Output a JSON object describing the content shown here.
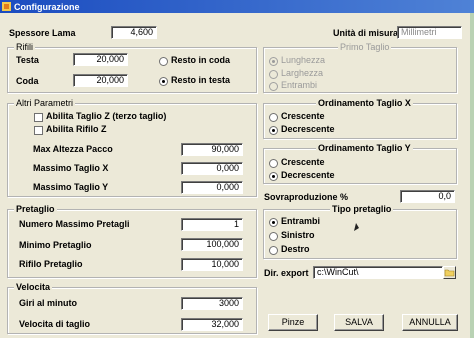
{
  "window": {
    "title": "Configurazione"
  },
  "spessore": {
    "label": "Spessore Lama",
    "value": "4,600"
  },
  "unita": {
    "label": "Unità di misura",
    "value": "Millimetri"
  },
  "rifili": {
    "legend": "Rifili",
    "testa_label": "Testa",
    "testa_value": "20,000",
    "coda_label": "Coda",
    "coda_value": "20,000",
    "opt_coda": "Resto in coda",
    "opt_testa": "Resto in testa"
  },
  "primo_taglio": {
    "legend": "Primo Taglio",
    "options": [
      "Lunghezza",
      "Larghezza",
      "Entrambi"
    ]
  },
  "altri": {
    "legend": "Altri Parametri",
    "check_z": "Abilita Taglio Z (terzo taglio)",
    "check_rifilo_z": "Abilita Rifilo Z",
    "max_pacco_label": "Max Altezza Pacco",
    "max_pacco_value": "90,000",
    "max_x_label": "Massimo Taglio X",
    "max_x_value": "0,000",
    "max_y_label": "Massimo Taglio Y",
    "max_y_value": "0,000"
  },
  "ord_x": {
    "legend": "Ordinamento Taglio X",
    "crescente": "Crescente",
    "decrescente": "Decrescente"
  },
  "ord_y": {
    "legend": "Ordinamento Taglio Y",
    "crescente": "Crescente",
    "decrescente": "Decrescente"
  },
  "sovra": {
    "label": "Sovraproduzione %",
    "value": "0,0"
  },
  "pretaglio": {
    "legend": "Pretaglio",
    "num_label": "Numero Massimo Pretagli",
    "num_value": "1",
    "min_label": "Minimo Pretaglio",
    "min_value": "100,000",
    "rif_label": "Rifilo Pretaglio",
    "rif_value": "10,000"
  },
  "tipo": {
    "legend": "Tipo pretaglio",
    "options": [
      "Entrambi",
      "Sinistro",
      "Destro"
    ]
  },
  "export": {
    "label": "Dir. export",
    "value": "c:\\WinCut\\"
  },
  "velocita": {
    "legend": "Velocita",
    "giri_label": "Giri al minuto",
    "giri_value": "3000",
    "vel_label": "Velocita di taglio",
    "vel_value": "32,000"
  },
  "buttons": {
    "pinze": "Pinze",
    "salva": "SALVA",
    "annulla": "ANNULLA"
  }
}
